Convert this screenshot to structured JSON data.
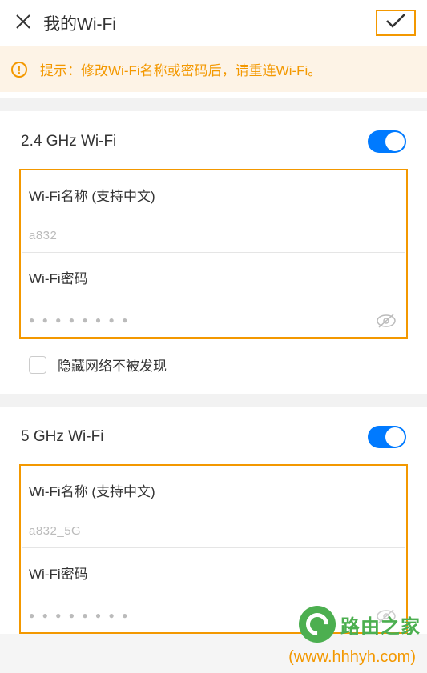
{
  "header": {
    "title": "我的Wi-Fi"
  },
  "tip": {
    "text": "提示：修改Wi-Fi名称或密码后，请重连Wi-Fi。"
  },
  "band24": {
    "title": "2.4 GHz Wi-Fi",
    "name_label": "Wi-Fi名称 (支持中文)",
    "name_value": "a832",
    "pwd_label": "Wi-Fi密码",
    "pwd_dots": "● ● ● ● ● ● ● ●",
    "hide_label": "隐藏网络不被发现"
  },
  "band5": {
    "title": "5 GHz Wi-Fi",
    "name_label": "Wi-Fi名称 (支持中文)",
    "name_value": "a832_5G",
    "pwd_label": "Wi-Fi密码",
    "pwd_dots": "● ● ● ● ● ● ● ●"
  },
  "watermark": {
    "text": "路由之家",
    "url": "(www.hhhyh.com)"
  }
}
